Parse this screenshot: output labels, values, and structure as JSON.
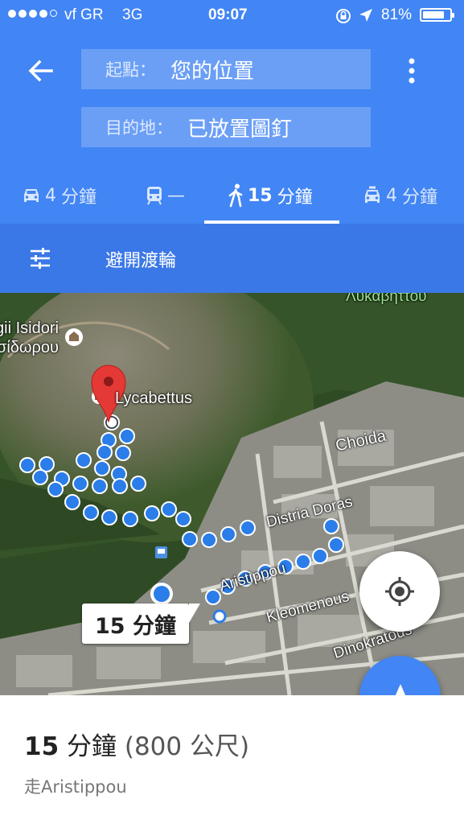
{
  "status_bar": {
    "carrier": "vf GR",
    "network": "3G",
    "time": "09:07",
    "battery": "81%",
    "battery_level": 0.81
  },
  "header": {
    "origin_label": "起點：",
    "origin_value": "您的位置",
    "destination_label": "目的地：",
    "destination_value": "已放置圖釘",
    "modes": [
      {
        "icon": "car-icon",
        "value": "4",
        "unit": "分鐘"
      },
      {
        "icon": "train-icon",
        "value": "—",
        "unit": ""
      },
      {
        "icon": "walk-icon",
        "value": "15",
        "unit": "分鐘",
        "active": true
      },
      {
        "icon": "taxi-icon",
        "value": "4",
        "unit": "分鐘"
      }
    ]
  },
  "options": {
    "avoid_label": "避開渡輪"
  },
  "map": {
    "labels": {
      "lykavittos_greek": "Λυκαβηττου",
      "isidori": "gii Isidori",
      "isidori_greek": "σίδωρου",
      "lycabettus": "Lycabettus",
      "choida": "Choida",
      "distria_doras": "Distria Doras",
      "aristippou": "Aristippou",
      "kleomenous": "Kleomenous",
      "dinokratous": "Dinokratous"
    },
    "duration_bubble": "15 分鐘",
    "colors": {
      "route": "#2b7de9",
      "pin": "#e53935",
      "accent": "#4285f4"
    }
  },
  "summary": {
    "duration_value": "15",
    "duration_unit": "分鐘",
    "distance": "(800 公尺)",
    "via": "走Aristippou"
  }
}
